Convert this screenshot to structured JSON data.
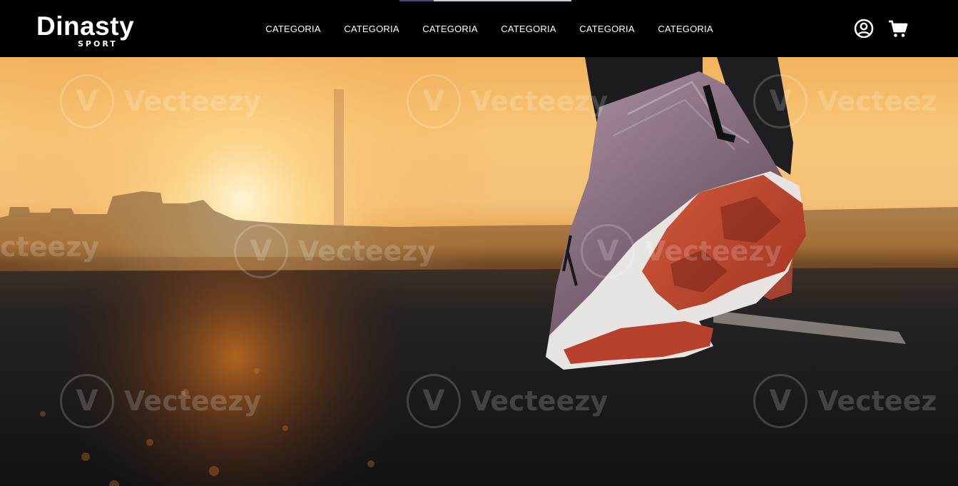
{
  "brand": {
    "name": "Dinasty",
    "tagline": "SPORT"
  },
  "nav": {
    "items": [
      {
        "label": "CATEGORIA"
      },
      {
        "label": "CATEGORIA"
      },
      {
        "label": "CATEGORIA"
      },
      {
        "label": "CATEGORIA"
      },
      {
        "label": "CATEGORIA"
      },
      {
        "label": "CATEGORIA"
      }
    ]
  },
  "icons": {
    "account": "user-circle-icon",
    "cart": "shopping-cart-icon"
  },
  "hero": {
    "watermark_text": "Vecteezy",
    "watermark_partial": "cteezy",
    "watermark_right_partial": "Vecteez"
  },
  "colors": {
    "navbar_bg": "#000000",
    "nav_text": "#ffffff",
    "sunset_orange": "#f3a44c",
    "shoe_sole": "#c84a33"
  }
}
